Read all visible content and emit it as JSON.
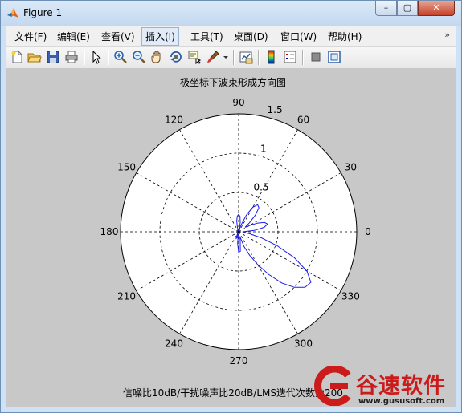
{
  "window": {
    "title": "Figure 1",
    "minimize": "–",
    "maximize": "▢",
    "close": "✕"
  },
  "menubar": {
    "items": [
      "文件(F)",
      "编辑(E)",
      "查看(V)",
      "插入(I)",
      "工具(T)",
      "桌面(D)",
      "窗口(W)",
      "帮助(H)"
    ],
    "active": "插入(I)",
    "overflow": "»"
  },
  "toolbar": {
    "icons": [
      "new-figure-icon",
      "open-file-icon",
      "save-icon",
      "print-icon",
      "pointer-icon",
      "zoom-in-icon",
      "zoom-out-icon",
      "pan-hand-icon",
      "rotate-3d-icon",
      "data-cursor-icon",
      "brush-icon",
      "brush-dropdown-icon",
      "link-plot-icon",
      "colorbar-icon",
      "legend-icon",
      "hide-plot-tools-icon",
      "show-plot-tools-icon"
    ]
  },
  "plot": {
    "title": "极坐标下波束形成方向图",
    "xlabel": "信噪比10dB/干扰噪声比20dB/LMS迭代次数为200",
    "angle_labels": [
      "0",
      "30",
      "60",
      "90",
      "120",
      "150",
      "180",
      "210",
      "240",
      "270",
      "300",
      "330"
    ],
    "radius_labels": [
      "0.5",
      "1",
      "1.5"
    ],
    "line_color": "#1a1aee"
  },
  "chart_data": {
    "type": "polar",
    "title": "极坐标下波束形成方向图",
    "xlabel": "信噪比10dB/干扰噪声比20dB/LMS迭代次数为200",
    "rlim": [
      0,
      1.5
    ],
    "r_ticks": [
      0.5,
      1,
      1.5
    ],
    "theta_ticks_deg": [
      0,
      30,
      60,
      90,
      120,
      150,
      180,
      210,
      240,
      270,
      300,
      330
    ],
    "grid": true,
    "series": [
      {
        "theta_deg": [
          0,
          5,
          10,
          15,
          20,
          25,
          30,
          35,
          40,
          45,
          50,
          55,
          60,
          65,
          70,
          75,
          80,
          85,
          90,
          95,
          100,
          105,
          110,
          115,
          120,
          130,
          140,
          150,
          160,
          170,
          180,
          190,
          200,
          210,
          220,
          230,
          240,
          245,
          250,
          255,
          260,
          265,
          270,
          275,
          280,
          285,
          290,
          295,
          300,
          305,
          310,
          315,
          320,
          325,
          330,
          335,
          340,
          345,
          350,
          355,
          360
        ],
        "r": [
          0.05,
          0.2,
          0.33,
          0.38,
          0.35,
          0.26,
          0.16,
          0.1,
          0.18,
          0.3,
          0.4,
          0.42,
          0.36,
          0.24,
          0.1,
          0.02,
          0.12,
          0.2,
          0.22,
          0.2,
          0.14,
          0.06,
          0.02,
          0.02,
          0.02,
          0.02,
          0.02,
          0.02,
          0.02,
          0.02,
          0.02,
          0.02,
          0.02,
          0.02,
          0.02,
          0.02,
          0.02,
          0.05,
          0.09,
          0.08,
          0.03,
          0.15,
          0.26,
          0.25,
          0.12,
          0.06,
          0.2,
          0.33,
          0.48,
          0.66,
          0.85,
          1.0,
          1.1,
          1.12,
          1.0,
          0.78,
          0.52,
          0.3,
          0.14,
          0.06,
          0.05
        ]
      }
    ]
  },
  "watermark": {
    "text": "谷速软件",
    "url": "www.gususoft.com",
    "color": "#cc1b1b"
  }
}
